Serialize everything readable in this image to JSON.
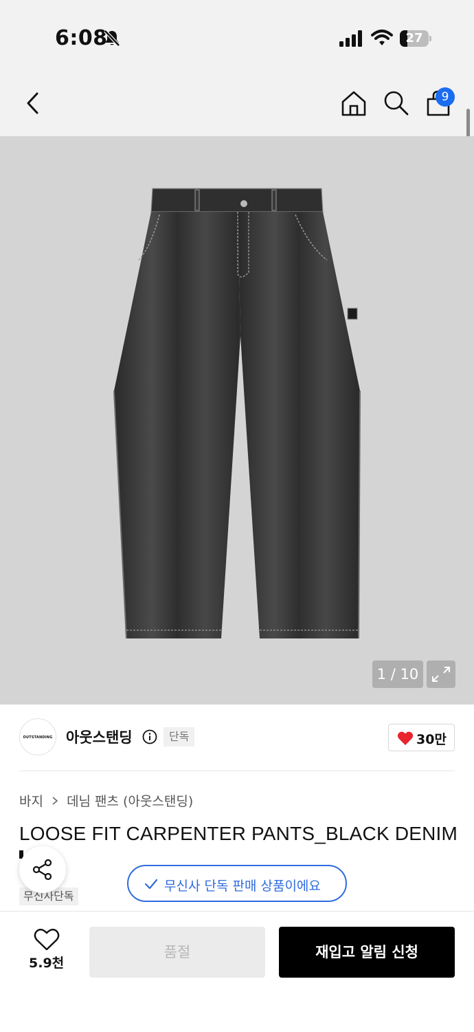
{
  "status_bar": {
    "time": "6:08",
    "battery": "27",
    "battery_level": 0.27,
    "icons": [
      "bell-slash-icon",
      "signal-icon",
      "wifi-icon",
      "battery-icon"
    ]
  },
  "nav": {
    "icons": [
      "back-chevron-icon",
      "home-icon",
      "search-icon",
      "cart-icon"
    ],
    "cart_count": "9"
  },
  "gallery": {
    "page_indicator": "1 / 10",
    "icons": [
      "expand-icon"
    ]
  },
  "brand": {
    "logo_text": "OUTSTANDING",
    "name": "아웃스탠딩",
    "exclusive_badge": "단독",
    "like_count": "30만",
    "icons": [
      "info-icon",
      "heart-icon"
    ]
  },
  "breadcrumb": {
    "category": "바지",
    "subcategory": "데님 팬츠 (아웃스탠딩)"
  },
  "product": {
    "title": "LOOSE FIT CARPENTER PANTS_BLACK DENIM",
    "tag": "무신사단독"
  },
  "toast": {
    "text": "무신사 단독 판매 상품이에요",
    "color": "#2f6bde"
  },
  "bottom_bar": {
    "wish_count": "5.9천",
    "soldout_label": "품절",
    "restock_label": "재입고 알림 신청"
  },
  "colors": {
    "accent_blue": "#2f6bde",
    "badge_blue": "#1a6cf0",
    "heart_red": "#e8242c"
  }
}
